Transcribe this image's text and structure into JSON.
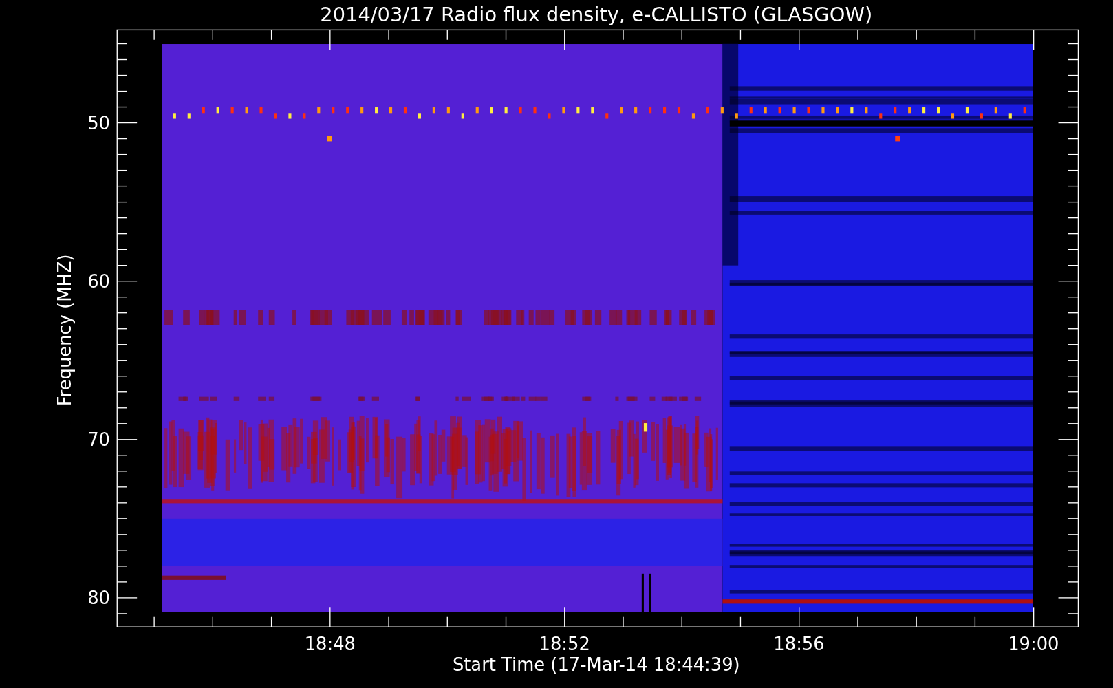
{
  "plot": {
    "title": "2014/03/17  Radio flux density, e-CALLISTO (GLASGOW)",
    "ylabel": "Frequency (MHZ)",
    "xlabel": "Start Time (17-Mar-14 18:44:39)",
    "yticks": [
      "50",
      "60",
      "70",
      "80"
    ],
    "xticks": [
      "18:48",
      "18:52",
      "18:56",
      "19:00"
    ]
  }
}
